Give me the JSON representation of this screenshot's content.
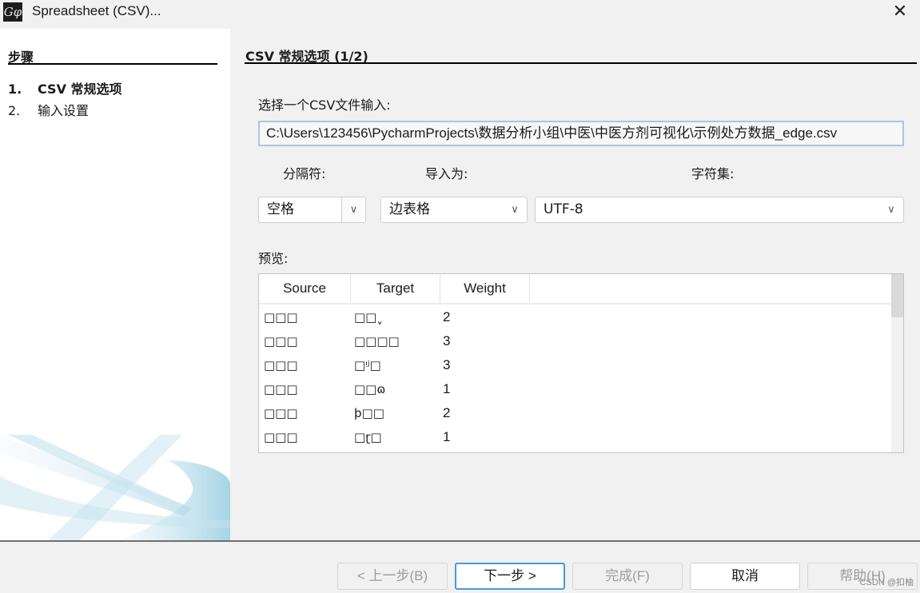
{
  "window": {
    "title": "Spreadsheet (CSV)...",
    "app_icon": "gephi-logo-icon",
    "close_icon": "close-icon",
    "close_glyph": "✕"
  },
  "sidebar": {
    "title": "步骤",
    "steps": [
      {
        "num": "1.",
        "label": "CSV 常规选项",
        "active": true
      },
      {
        "num": "2.",
        "label": "输入设置",
        "active": false
      }
    ]
  },
  "main": {
    "title": "CSV 常规选项 (1/2)",
    "file_label": "选择一个CSV文件输入:",
    "file_path": "C:\\Users\\123456\\PycharmProjects\\数据分析小组\\中医\\中医方剂可视化\\示例处方数据_edge.csv",
    "separator_label": "分隔符:",
    "import_as_label": "导入为:",
    "charset_label": "字符集:",
    "separator_value": "空格",
    "import_as_value": "边表格",
    "charset_value": "UTF-8",
    "dropdown_glyph": "∨",
    "preview_label": "预览:"
  },
  "preview_table": {
    "columns": [
      "Source",
      "Target",
      "Weight"
    ],
    "rows": [
      {
        "source": "□□□",
        "target": "□□ˬ",
        "weight": "2"
      },
      {
        "source": "□□□",
        "target": "□□□□",
        "weight": "3"
      },
      {
        "source": "□□□",
        "target": "□ᵎʲ□",
        "weight": "3"
      },
      {
        "source": "□□□",
        "target": "□□ɷ",
        "weight": "1"
      },
      {
        "source": "□□□",
        "target": "þ□□",
        "weight": "2"
      },
      {
        "source": "□□□",
        "target": "□ɽ□",
        "weight": "1"
      }
    ]
  },
  "buttons": {
    "back": "< 上一步(B)",
    "next": "下一步 >",
    "finish": "完成(F)",
    "cancel": "取消",
    "help": "帮助(H)"
  },
  "watermark": "CSDN @扣柚"
}
